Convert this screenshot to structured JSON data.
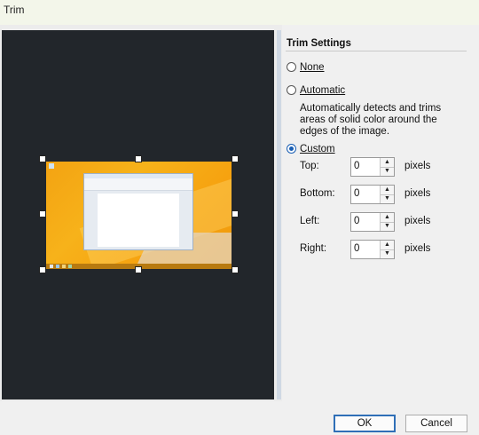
{
  "window": {
    "title": "Trim"
  },
  "trim_settings": {
    "heading": "Trim Settings",
    "options": {
      "none": {
        "label": "None",
        "checked": false
      },
      "automatic": {
        "label": "Automatic",
        "checked": false,
        "description": "Automatically detects and trims areas of solid color around the edges of the image."
      },
      "custom": {
        "label": "Custom",
        "checked": true
      }
    },
    "fields": {
      "top": {
        "label": "Top:",
        "value": "0",
        "unit": "pixels"
      },
      "bottom": {
        "label": "Bottom:",
        "value": "0",
        "unit": "pixels"
      },
      "left": {
        "label": "Left:",
        "value": "0",
        "unit": "pixels"
      },
      "right": {
        "label": "Right:",
        "value": "0",
        "unit": "pixels"
      }
    }
  },
  "buttons": {
    "ok": "OK",
    "cancel": "Cancel"
  },
  "colors": {
    "accent": "#1a5fb4",
    "preview_background": "#22262b",
    "default_button_border": "#2f6fb7"
  }
}
